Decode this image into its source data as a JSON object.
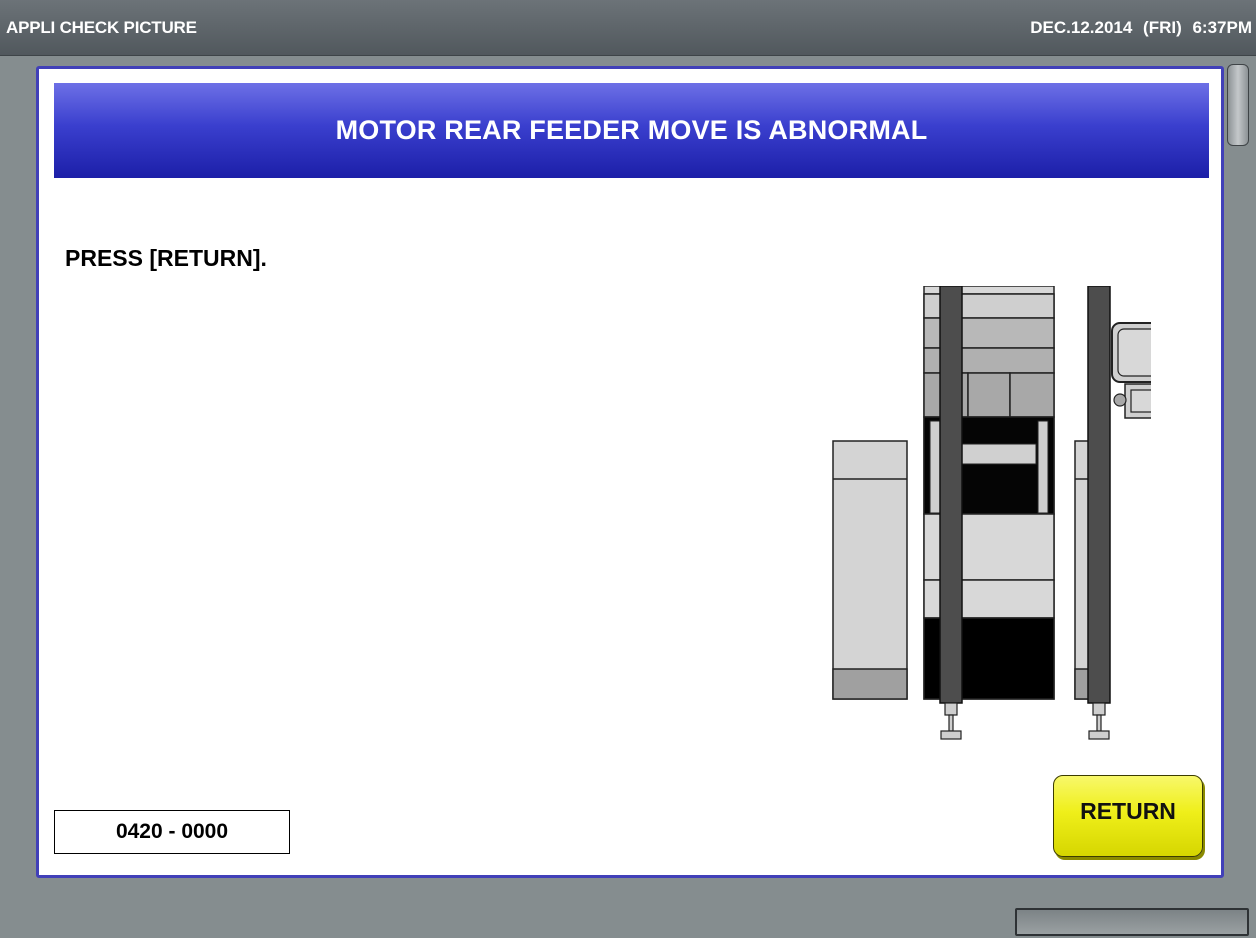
{
  "titlebar": {
    "app_title": "APPLI CHECK PICTURE",
    "datetime": "DEC.12.2014 (FRI)  6:37PM"
  },
  "dialog": {
    "title": "MOTOR REAR FEEDER MOVE IS ABNORMAL",
    "instruction": "PRESS [RETURN].",
    "error_code": "0420 - 0000",
    "return_label": "RETURN"
  },
  "colors": {
    "header_blue": "#2a2fc0",
    "button_yellow": "#efef1a",
    "background": "#858d8f"
  },
  "icons": {
    "machine": "mounter-machine-illustration"
  }
}
